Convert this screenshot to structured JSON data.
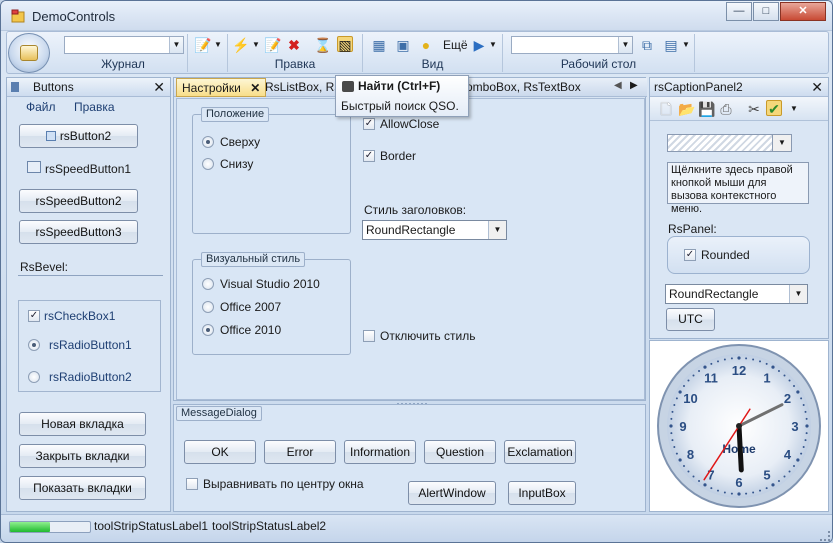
{
  "window": {
    "title": "DemoControls"
  },
  "ribbon": {
    "groups": [
      {
        "label": "Журнал"
      },
      {
        "label": "Правка"
      },
      {
        "label": "Вид",
        "more_label": "Ещё"
      },
      {
        "label": "Рабочий стол"
      }
    ]
  },
  "left_panel": {
    "title": "Buttons",
    "menu": [
      "Файл",
      "Правка"
    ],
    "buttons": [
      "rsButton2",
      "rsSpeedButton1",
      "rsSpeedButton2",
      "rsSpeedButton3"
    ],
    "bevel_label": "RsBevel:",
    "checkbox1": "rsCheckBox1",
    "radio1": "rsRadioButton1",
    "radio2": "rsRadioButton2",
    "actions": [
      "Новая вкладка",
      "Закрыть вкладки",
      "Показать вкладки"
    ]
  },
  "tabs": {
    "items": [
      "Настройки",
      "RsListBox, RsM",
      "omboBox, RsTextBox"
    ],
    "tooltip_title": "Найти (Ctrl+F)",
    "tooltip_text": "Быстрый поиск QSO."
  },
  "settings": {
    "position_title": "Положение",
    "pos_top": "Сверху",
    "pos_bottom": "Снизу",
    "allow_close": "AllowClose",
    "border": "Border",
    "header_style_label": "Стиль заголовков:",
    "header_style_value": "RoundRectangle",
    "visual_style_title": "Визуальный стиль",
    "vs_options": [
      "Visual Studio 2010",
      "Office 2007",
      "Office 2010"
    ],
    "disable_style": "Отключить стиль"
  },
  "message_dialog": {
    "title": "MessageDialog",
    "buttons": [
      "OK",
      "Error",
      "Information",
      "Question",
      "Exclamation"
    ],
    "center_label": "Выравнивать по центру окна",
    "alert": "AlertWindow",
    "input": "InputBox"
  },
  "caption_panel": {
    "title": "rsCaptionPanel2",
    "hint": "Щёлкните здесь правой кнопкой мыши для вызова контекстного меню.",
    "rspanel_label": "RsPanel:",
    "rounded": "Rounded",
    "combo_value": "RoundRectangle",
    "utc": "UTC"
  },
  "clock": {
    "label": "Home",
    "numbers": [
      "12",
      "1",
      "2",
      "3",
      "4",
      "5",
      "6",
      "7",
      "8",
      "9",
      "10",
      "11"
    ],
    "hour": 5.9,
    "minute": 10.6,
    "second": 35.5
  },
  "status": {
    "label1": "toolStripStatusLabel1",
    "label2": "toolStripStatusLabel2",
    "progress": 0.5
  },
  "icons": {
    "app": "app-icon",
    "close": "close-icon",
    "dropdown": "chevron-down-icon"
  }
}
